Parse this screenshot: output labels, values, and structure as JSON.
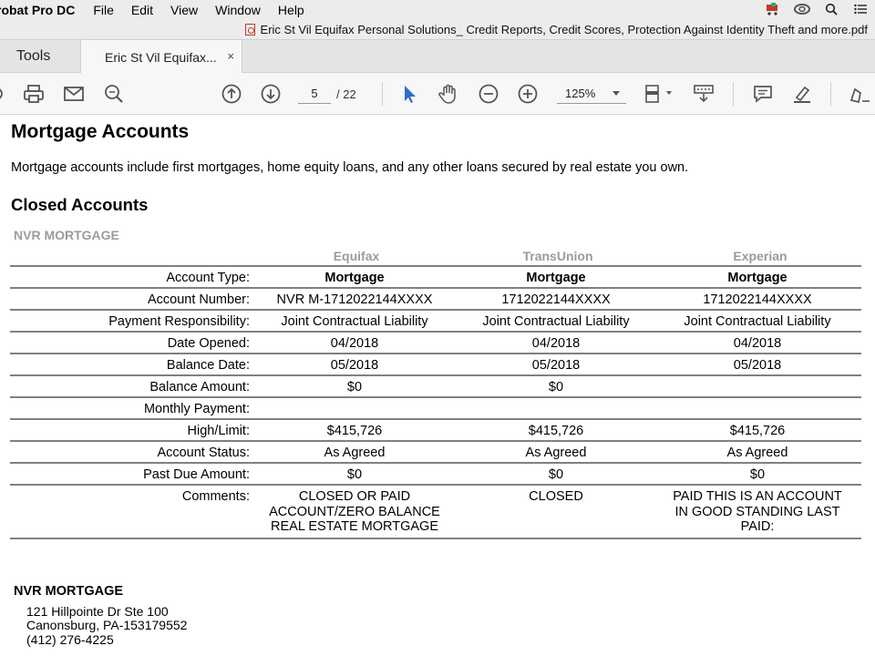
{
  "menubar": {
    "app_name": "robat Pro DC",
    "items": [
      "File",
      "Edit",
      "View",
      "Window",
      "Help"
    ]
  },
  "window": {
    "title": "Eric St Vil Equifax Personal Solutions_ Credit Reports, Credit Scores, Protection Against Identity Theft and more.pdf"
  },
  "tabs": {
    "tools_label": "Tools",
    "doc_label": "Eric St Vil Equifax...",
    "close_glyph": "×"
  },
  "toolbar": {
    "page_current": "5",
    "page_total": "/ 22",
    "zoom": "125%",
    "icons": [
      "print-icon",
      "mail-icon",
      "search-icon",
      "page-up-icon",
      "page-down-icon",
      "select-cursor-icon",
      "hand-icon",
      "zoom-out-icon",
      "zoom-in-icon",
      "fit-page-icon",
      "scroll-mode-icon",
      "comment-icon",
      "highlight-icon",
      "sign-icon"
    ],
    "accent": "#2d6fcb"
  },
  "document": {
    "section_title": "Mortgage Accounts",
    "intro": "Mortgage accounts include first mortgages, home equity loans, and any other loans secured by real estate you own.",
    "subsection_title": "Closed Accounts",
    "creditor": "NVR MORTGAGE",
    "bureaus": [
      "Equifax",
      "TransUnion",
      "Experian"
    ],
    "rows": [
      {
        "label": "Account Type:",
        "values": [
          "Mortgage",
          "Mortgage",
          "Mortgage"
        ]
      },
      {
        "label": "Account Number:",
        "values": [
          "NVR M-1712022144XXXX",
          "1712022144XXXX",
          "1712022144XXXX"
        ]
      },
      {
        "label": "Payment Responsibility:",
        "values": [
          "Joint Contractual Liability",
          "Joint Contractual Liability",
          "Joint Contractual Liability"
        ]
      },
      {
        "label": "Date Opened:",
        "values": [
          "04/2018",
          "04/2018",
          "04/2018"
        ]
      },
      {
        "label": "Balance Date:",
        "values": [
          "05/2018",
          "05/2018",
          "05/2018"
        ]
      },
      {
        "label": "Balance Amount:",
        "values": [
          "$0",
          "$0",
          ""
        ]
      },
      {
        "label": "Monthly Payment:",
        "values": [
          "",
          "",
          ""
        ]
      },
      {
        "label": "High/Limit:",
        "values": [
          "$415,726",
          "$415,726",
          "$415,726"
        ]
      },
      {
        "label": "Account Status:",
        "values": [
          "As Agreed",
          "As Agreed",
          "As Agreed"
        ]
      },
      {
        "label": "Past Due Amount:",
        "values": [
          "$0",
          "$0",
          "$0"
        ]
      },
      {
        "label": "Comments:",
        "values": [
          "CLOSED OR PAID\nACCOUNT/ZERO BALANCE\nREAL ESTATE MORTGAGE",
          "CLOSED",
          "PAID THIS IS AN ACCOUNT\nIN GOOD STANDING LAST\nPAID:"
        ]
      }
    ],
    "address": {
      "name": "NVR MORTGAGE",
      "line1": "121 Hillpointe Dr Ste 100",
      "line2": "Canonsburg, PA-153179552",
      "phone": "(412) 276-4225"
    }
  }
}
